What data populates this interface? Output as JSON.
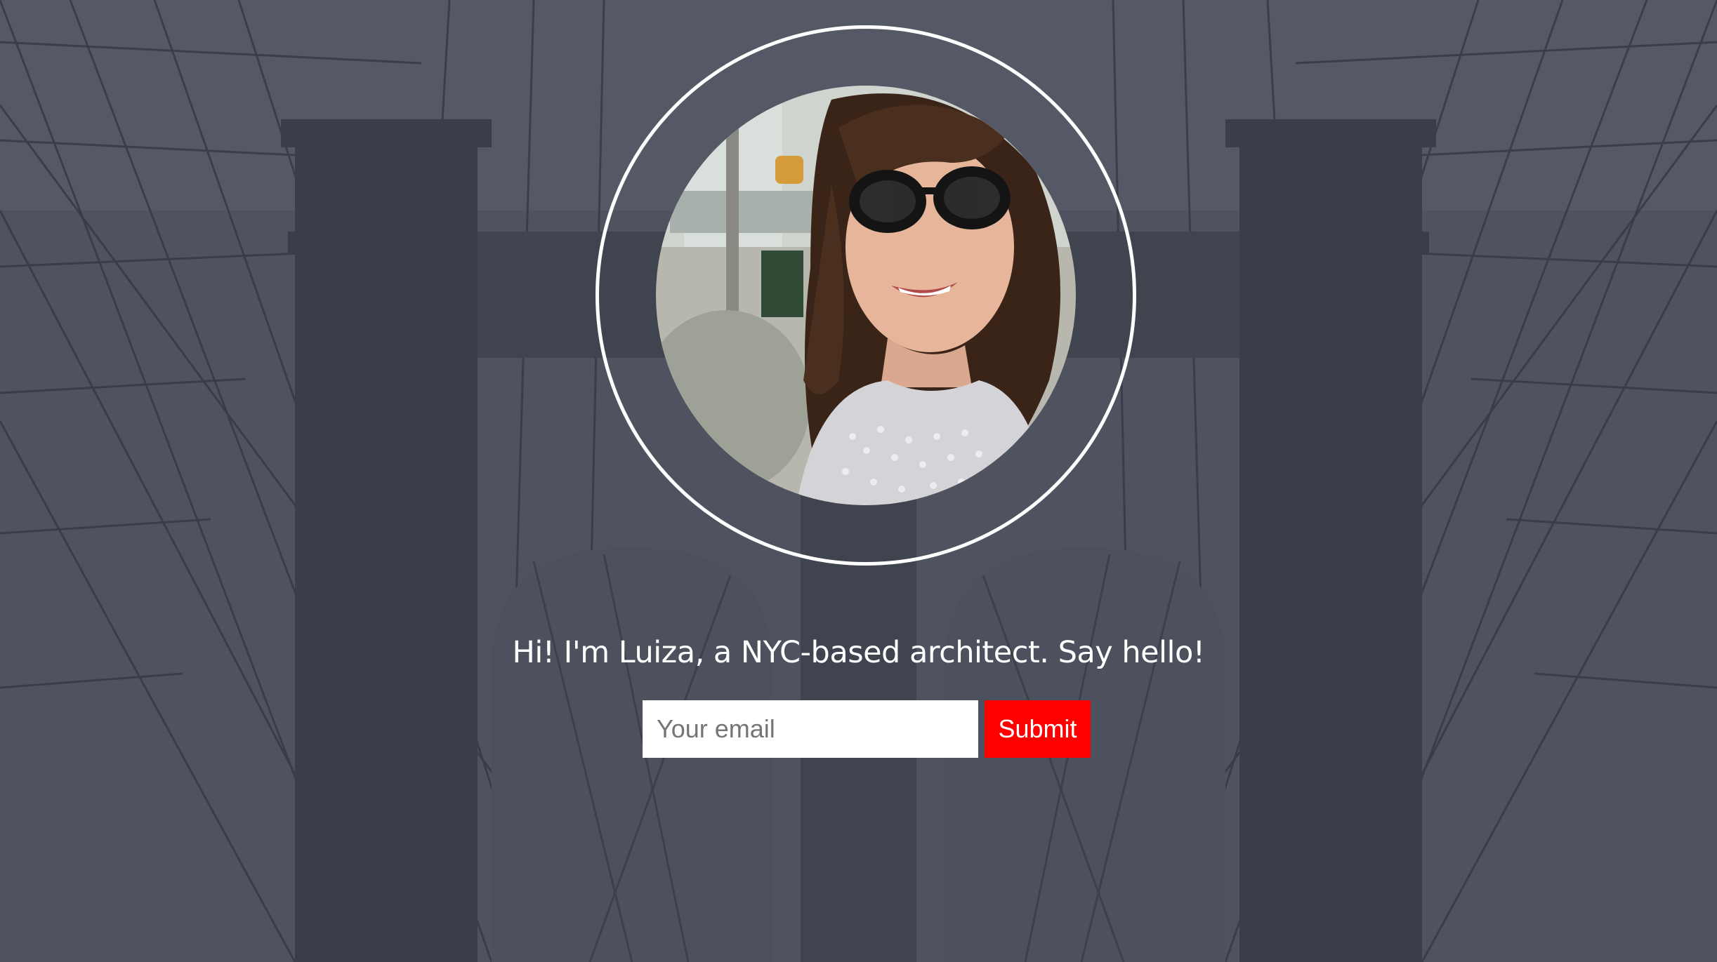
{
  "hero": {
    "background_description": "grayscale bridge background",
    "overlay_color": "#3d4150"
  },
  "profile": {
    "photo_alt": "Profile photo of Luiza"
  },
  "intro": {
    "tagline": "Hi! I'm Luiza, a NYC-based architect. Say hello!"
  },
  "signup": {
    "email_value": "",
    "email_placeholder": "Your email",
    "submit_label": "Submit",
    "submit_color": "#ff0000"
  }
}
